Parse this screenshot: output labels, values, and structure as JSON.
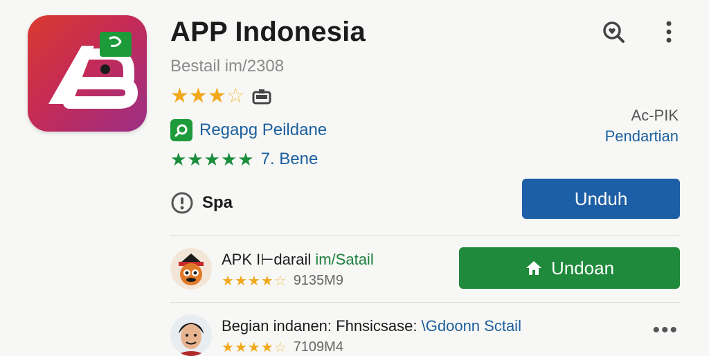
{
  "app": {
    "title": "APP Indonesia",
    "subtitle": "Bestail im/2308",
    "rating_stars": 3,
    "developer": "Regapg Peildane",
    "green_label": "7. Bene",
    "info_label": "Spa",
    "meta_line1": "Ac-PIK",
    "meta_line2": "Pendartian",
    "download_button": "Unduh"
  },
  "icons": {
    "search": "search-heart-icon",
    "more": "more-vertical-icon",
    "category": "category-badge-icon",
    "developer": "search-badge-icon",
    "info": "info-circle-icon",
    "home": "home-icon",
    "overflow": "more-horizontal-icon"
  },
  "list": [
    {
      "title_main": "APK I⊢darail ",
      "title_accent": "im/Satail",
      "meta": "9135M9",
      "button": "Undoan"
    },
    {
      "title_main": "Begian indanen: Fhnsicsase: ",
      "title_accent": "\\Gdoonn Sctail",
      "meta": "7109M4"
    }
  ],
  "colors": {
    "download": "#1d5fa6",
    "install": "#1f8a3b",
    "link": "#1b5f9e",
    "star": "#f2a81b"
  }
}
